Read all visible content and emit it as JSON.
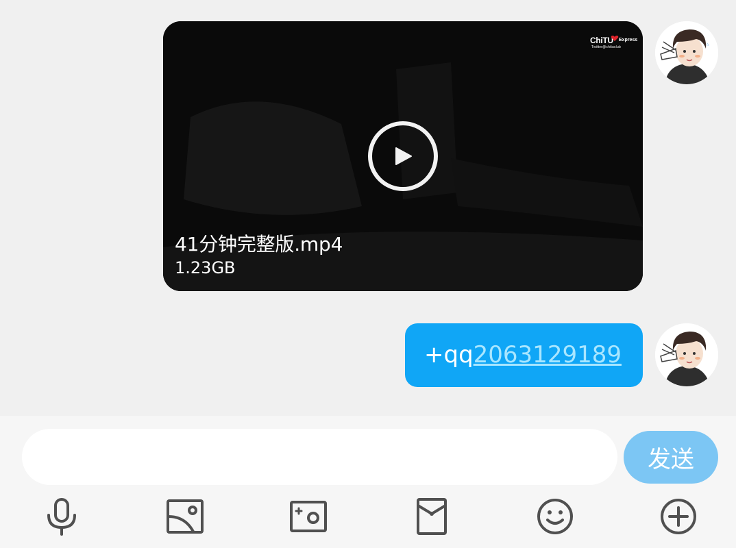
{
  "messages": [
    {
      "type": "video",
      "watermark": {
        "brand": "ChiTU",
        "brand_sub": "Express",
        "line": "Twitter@chituclub"
      },
      "filename": "41分钟完整版.mp4",
      "filesize": "1.23GB"
    },
    {
      "type": "text",
      "prefix": "+qq",
      "link": "2063129189"
    }
  ],
  "composer": {
    "input_value": "",
    "send_label": "发送"
  },
  "toolbar": [
    {
      "icon": "microphone-icon"
    },
    {
      "icon": "image-icon"
    },
    {
      "icon": "camera-icon"
    },
    {
      "icon": "red-packet-icon"
    },
    {
      "icon": "emoji-icon"
    },
    {
      "icon": "plus-circle-icon"
    }
  ],
  "colors": {
    "bubble": "#10a6f6",
    "link": "#a9e6ff",
    "send_button": "#7cc6f4",
    "icon": "#505050"
  }
}
